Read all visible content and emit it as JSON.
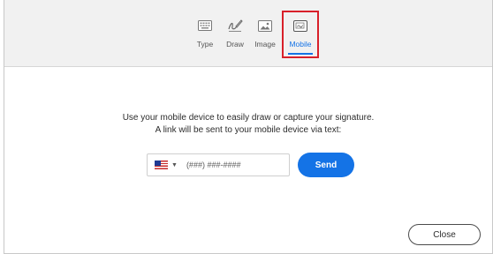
{
  "tabs": [
    {
      "label": "Type",
      "icon": "keyboard-icon"
    },
    {
      "label": "Draw",
      "icon": "pen-icon"
    },
    {
      "label": "Image",
      "icon": "image-icon"
    },
    {
      "label": "Mobile",
      "icon": "mobile-icon"
    }
  ],
  "message": {
    "line1": "Use your mobile device to easily draw or capture your signature.",
    "line2": "A link will be sent to your mobile device via text:"
  },
  "phone": {
    "country": "US",
    "placeholder": "(###) ###-####"
  },
  "buttons": {
    "send": "Send",
    "close": "Close"
  },
  "colors": {
    "accent": "#1473e6",
    "highlight": "#d8202a"
  }
}
